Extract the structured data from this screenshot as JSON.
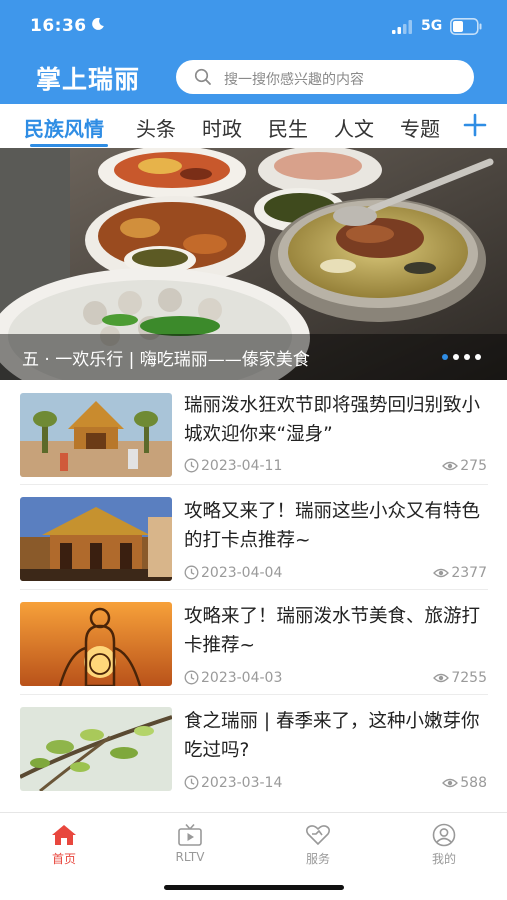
{
  "status_bar": {
    "time": "16:36",
    "network": "5G"
  },
  "header": {
    "app_title": "掌上瑞丽",
    "search_placeholder": "搜一搜你感兴趣的内容"
  },
  "tabs": [
    {
      "label": "民族风情",
      "active": true
    },
    {
      "label": "头条",
      "active": false
    },
    {
      "label": "时政",
      "active": false
    },
    {
      "label": "民生",
      "active": false
    },
    {
      "label": "人文",
      "active": false
    },
    {
      "label": "专题",
      "active": false
    }
  ],
  "banner": {
    "caption": "五 · 一欢乐行 | 嗨吃瑞丽——傣家美食",
    "slide_count": 4,
    "active_slide": 1
  },
  "news": [
    {
      "title": "瑞丽泼水狂欢节即将强势回归别致小城欢迎你来“湿身”",
      "date": "2023-04-11",
      "views": "275"
    },
    {
      "title": "攻略又来了！瑞丽这些小众又有特色的打卡点推荐~",
      "date": "2023-04-04",
      "views": "2377"
    },
    {
      "title": "攻略来了！瑞丽泼水节美食、旅游打卡推荐~",
      "date": "2023-04-03",
      "views": "7255"
    },
    {
      "title": "食之瑞丽 | 春季来了，这种小嫩芽你吃过吗?",
      "date": "2023-03-14",
      "views": "588"
    }
  ],
  "bottom_nav": [
    {
      "label": "首页",
      "icon": "home-icon",
      "active": true
    },
    {
      "label": "RLTV",
      "icon": "tv-icon",
      "active": false
    },
    {
      "label": "服务",
      "icon": "service-icon",
      "active": false
    },
    {
      "label": "我的",
      "icon": "profile-icon",
      "active": false
    }
  ],
  "colors": {
    "header_blue": "#3f97eb",
    "accent_blue": "#2f8de4",
    "nav_active_red": "#e8473e"
  }
}
